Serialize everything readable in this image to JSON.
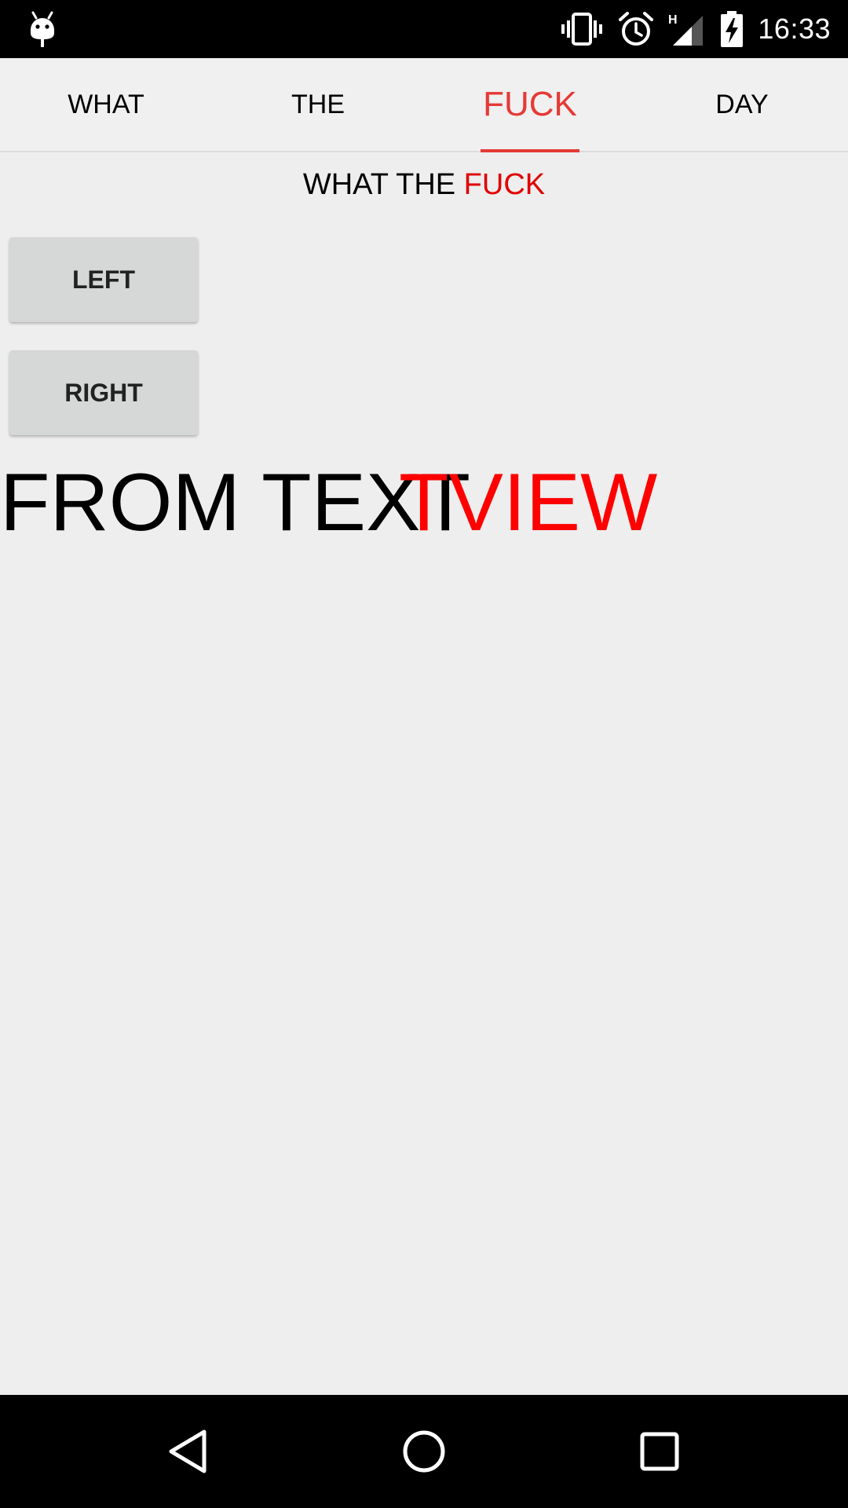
{
  "status_bar": {
    "time": "16:33",
    "icons": [
      "android-debug-icon",
      "vibrate-icon",
      "alarm-icon",
      "network-h-icon",
      "signal-icon",
      "battery-charging-icon"
    ],
    "network_type": "H"
  },
  "tabs": [
    {
      "label": "WHAT",
      "selected": false
    },
    {
      "label": "THE",
      "selected": false
    },
    {
      "label": "FUCK",
      "selected": true
    },
    {
      "label": "DAY",
      "selected": false
    }
  ],
  "subtitle": {
    "prefix": "WHAT THE ",
    "accent": "FUCK"
  },
  "buttons": {
    "left_label": "LEFT",
    "right_label": "RIGHT"
  },
  "big_text": {
    "black_part": "FROM TEXT",
    "red_part": "TVIEW"
  },
  "colors": {
    "accent": "#e53935",
    "text_red": "#ff0000",
    "background": "#eeeeee",
    "button": "#d6d7d7"
  },
  "nav_bar": {
    "icons": [
      "back-icon",
      "home-icon",
      "recent-apps-icon"
    ]
  }
}
